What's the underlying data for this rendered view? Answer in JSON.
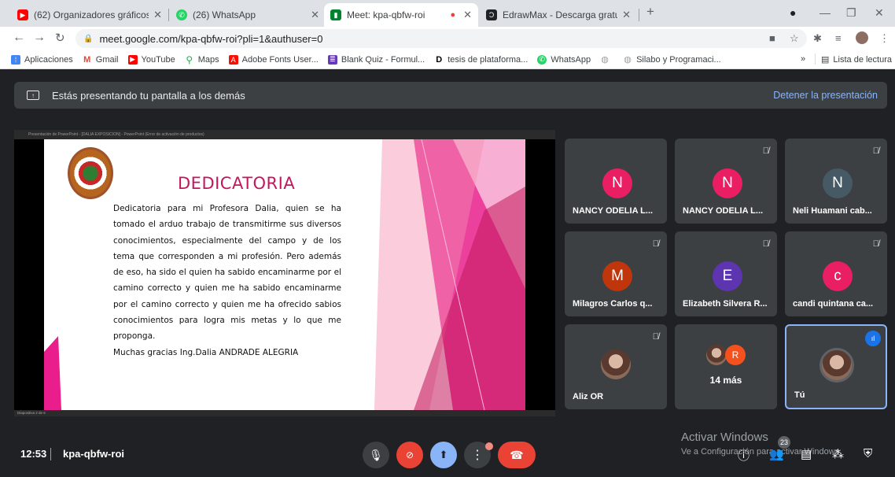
{
  "tabs": [
    {
      "title": "(62) Organizadores gráficos - You",
      "fav_color": "#ff0000"
    },
    {
      "title": "(26) WhatsApp",
      "fav_color": "#25d366"
    },
    {
      "title": "Meet: kpa-qbfw-roi",
      "fav_color": "#00832d"
    },
    {
      "title": "EdrawMax - Descarga gratuita",
      "fav_color": "#202124"
    }
  ],
  "url": "meet.google.com/kpa-qbfw-roi?pli=1&authuser=0",
  "bookmarks": [
    {
      "label": "Aplicaciones",
      "color": "#4285f4"
    },
    {
      "label": "Gmail",
      "color": "#ea4335"
    },
    {
      "label": "YouTube",
      "color": "#ff0000"
    },
    {
      "label": "Maps",
      "color": "#34a853"
    },
    {
      "label": "Adobe Fonts User...",
      "color": "#fa0f00"
    },
    {
      "label": "Blank Quiz - Formul...",
      "color": "#673ab7"
    },
    {
      "label": "tesis de plataforma...",
      "color": "#000000"
    },
    {
      "label": "WhatsApp",
      "color": "#25d366"
    },
    {
      "label": "",
      "color": "#9aa0a6"
    },
    {
      "label": "Silabo y Programaci...",
      "color": "#9aa0a6"
    }
  ],
  "bookmarks_more": "»",
  "reading_list": "Lista de lectura",
  "banner": {
    "text": "Estás presentando tu pantalla a los demás",
    "stop": "Detener la presentación"
  },
  "ppt": {
    "titlebar": "Presentación de PowerPoint - [DALIA EXPOSICION] - PowerPoint (Error de activación de productos)",
    "footer": "Diapositiva 2 de 6"
  },
  "slide": {
    "title": "DEDICATORIA",
    "body": "Dedicatoria para mi Profesora Dalia, quien se ha tomado el arduo trabajo de transmitirme sus diversos conocimientos, especialmente del campo y de los tema que corresponden a mi profesión. Pero además de eso, ha sido el quien ha sabido encaminarme por el camino correcto y quien me ha sabido encaminarme por el camino correcto y quien me ha ofrecido sabios conocimientos   para logra mis metas y lo que me proponga.",
    "thanks": "Muchas gracias Ing.Dalia ANDRADE ALEGRIA"
  },
  "participants": [
    {
      "name": "NANCY ODELIA L...",
      "initial": "N",
      "color": "#e91e63",
      "muted": false
    },
    {
      "name": "NANCY ODELIA L...",
      "initial": "N",
      "color": "#e91e63",
      "muted": true
    },
    {
      "name": "Neli Huamani cab...",
      "initial": "N",
      "color": "#455a64",
      "muted": true
    },
    {
      "name": "Milagros Carlos q...",
      "initial": "M",
      "color": "#bf360c",
      "muted": true
    },
    {
      "name": "Elizabeth Silvera R...",
      "initial": "E",
      "color": "#5e35b1",
      "muted": true
    },
    {
      "name": "candi quintana ca...",
      "initial": "c",
      "color": "#e91e63",
      "muted": true
    },
    {
      "name": "Aliz OR",
      "initial": "",
      "color": "",
      "muted": true
    },
    {
      "name": "14 más",
      "initial": "R",
      "color": "#f4511e",
      "muted": false
    },
    {
      "name": "Tú",
      "initial": "",
      "color": "",
      "muted": false
    }
  ],
  "bottom": {
    "time": "12:53",
    "meeting_code": "kpa-qbfw-roi",
    "activate_title": "Activar Windows",
    "activate_sub": "Ve a Configuración para activar Windows.",
    "participants_count": "23"
  }
}
